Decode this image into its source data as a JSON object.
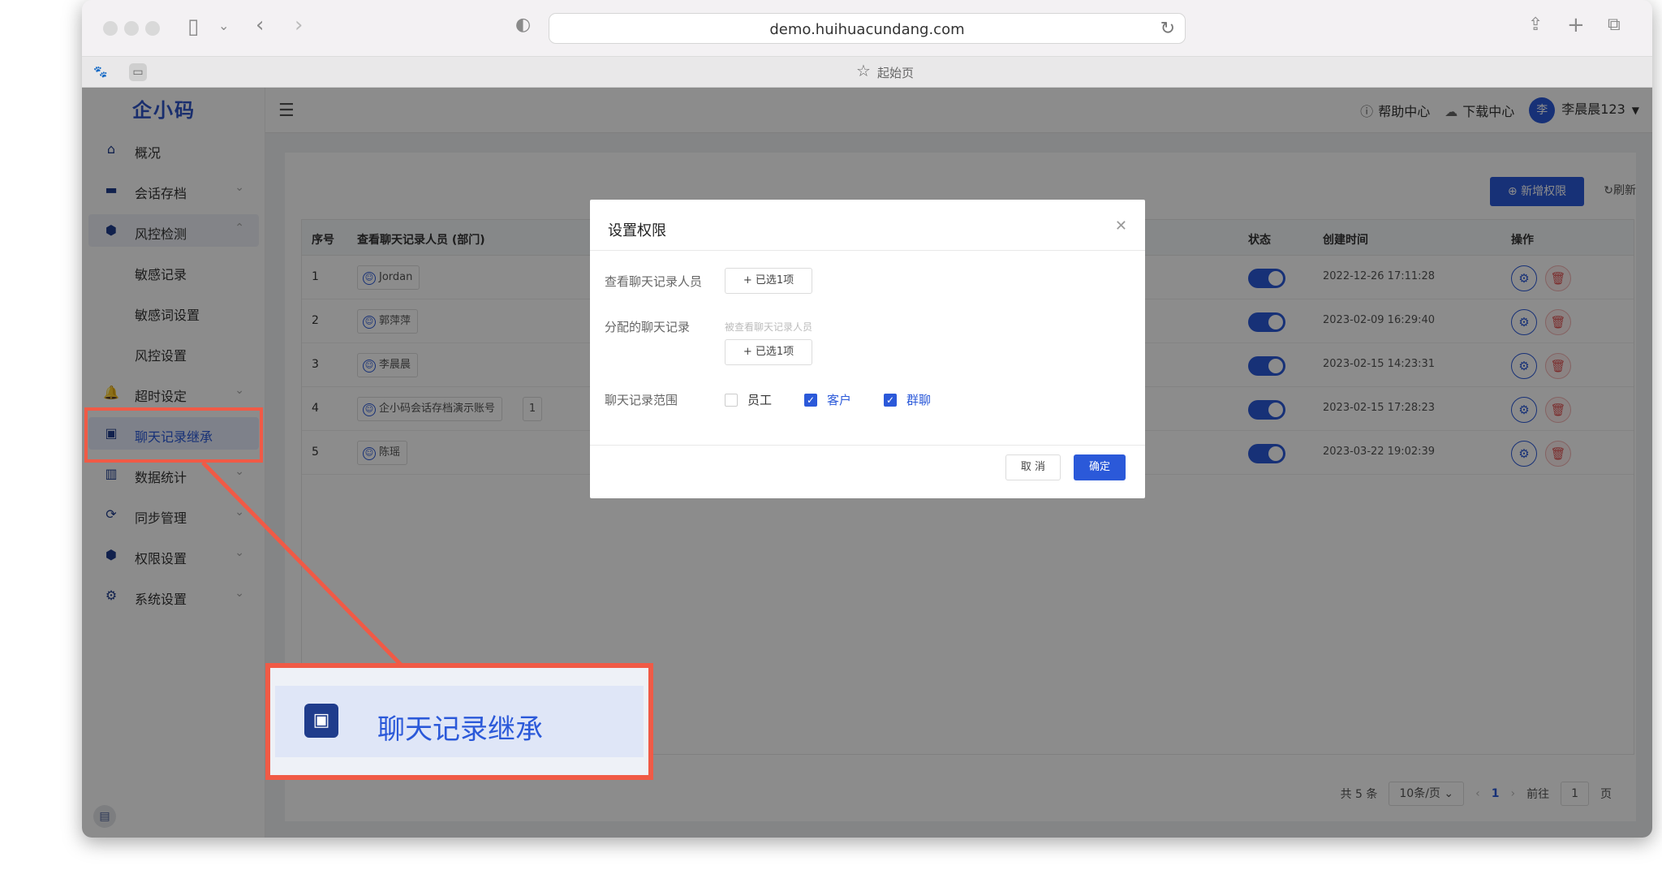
{
  "browser": {
    "url": "demo.huihuacundang.com",
    "tab_title": "起始页"
  },
  "app": {
    "logo": "企小码",
    "topbar": {
      "help": "帮助中心",
      "download": "下载中心",
      "avatar_text": "李",
      "username": "李晨晨123"
    },
    "sidebar": {
      "items": [
        {
          "label": "概况",
          "icon": "home-icon"
        },
        {
          "label": "会话存档",
          "icon": "folder-icon"
        },
        {
          "label": "风控检测",
          "icon": "shield-icon"
        },
        {
          "label": "敏感记录"
        },
        {
          "label": "敏感词设置"
        },
        {
          "label": "风控设置"
        },
        {
          "label": "超时设定",
          "icon": "bell-icon"
        },
        {
          "label": "聊天记录继承",
          "icon": "contact-card-icon"
        },
        {
          "label": "数据统计",
          "icon": "bar-chart-icon"
        },
        {
          "label": "同步管理",
          "icon": "sync-icon"
        },
        {
          "label": "权限设置",
          "icon": "shield-icon"
        },
        {
          "label": "系统设置",
          "icon": "gear-icon"
        }
      ]
    },
    "toolbar": {
      "add_label": "新增权限",
      "refresh_label": "刷新"
    },
    "table": {
      "headers": [
        "序号",
        "查看聊天记录人员 (部门)",
        "状态",
        "创建时间",
        "操作"
      ],
      "rows": [
        {
          "idx": "1",
          "person": "Jordan",
          "more": "",
          "time": "2022-12-26 17:11:28"
        },
        {
          "idx": "2",
          "person": "郭萍萍",
          "more": "",
          "time": "2023-02-09 16:29:40"
        },
        {
          "idx": "3",
          "person": "李晨晨",
          "more": "",
          "time": "2023-02-15 14:23:31"
        },
        {
          "idx": "4",
          "person": "企小码会话存档演示账号",
          "more": "1",
          "time": "2023-02-15 17:28:23"
        },
        {
          "idx": "5",
          "person": "陈瑶",
          "more": "",
          "time": "2023-03-22 19:02:39"
        }
      ]
    },
    "pager": {
      "total": "共 5 条",
      "page_size": "10条/页",
      "current": "1",
      "goto_label": "前往",
      "goto_value": "1",
      "goto_suffix": "页"
    }
  },
  "dialog": {
    "title": "设置权限",
    "viewer_label": "查看聊天记录人员",
    "viewer_btn": "+ 已选1项",
    "assign_label": "分配的聊天记录",
    "assign_hint": "被查看聊天记录人员",
    "assign_btn": "+ 已选1项",
    "scope_label": "聊天记录范围",
    "scope_options": [
      {
        "label": "员工",
        "checked": false
      },
      {
        "label": "客户",
        "checked": true
      },
      {
        "label": "群聊",
        "checked": true
      }
    ],
    "cancel": "取 消",
    "ok": "确定"
  },
  "annotation": {
    "zoom_label": "聊天记录继承",
    "color": "#f05a46"
  }
}
